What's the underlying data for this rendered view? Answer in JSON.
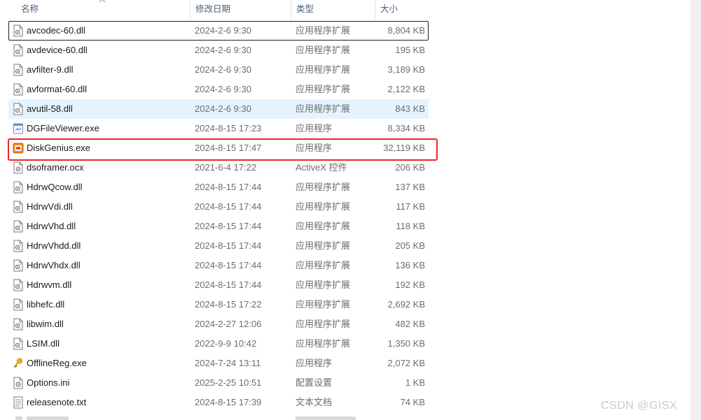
{
  "header": {
    "name": "名称",
    "date": "修改日期",
    "type": "类型",
    "size": "大小"
  },
  "files": [
    {
      "name": "avcodec-60.dll",
      "date": "2024-2-6 9:30",
      "type": "应用程序扩展",
      "size": "8,804 KB",
      "icon": "dll-file-icon"
    },
    {
      "name": "avdevice-60.dll",
      "date": "2024-2-6 9:30",
      "type": "应用程序扩展",
      "size": "195 KB",
      "icon": "dll-file-icon"
    },
    {
      "name": "avfilter-9.dll",
      "date": "2024-2-6 9:30",
      "type": "应用程序扩展",
      "size": "3,189 KB",
      "icon": "dll-file-icon"
    },
    {
      "name": "avformat-60.dll",
      "date": "2024-2-6 9:30",
      "type": "应用程序扩展",
      "size": "2,122 KB",
      "icon": "dll-file-icon"
    },
    {
      "name": "avutil-58.dll",
      "date": "2024-2-6 9:30",
      "type": "应用程序扩展",
      "size": "843 KB",
      "icon": "dll-file-icon"
    },
    {
      "name": "DGFileViewer.exe",
      "date": "2024-8-15 17:23",
      "type": "应用程序",
      "size": "8,334 KB",
      "icon": "exe-generic-icon"
    },
    {
      "name": "DiskGenius.exe",
      "date": "2024-8-15 17:47",
      "type": "应用程序",
      "size": "32,119 KB",
      "icon": "diskgenius-app-icon"
    },
    {
      "name": "dsoframer.ocx",
      "date": "2021-6-4 17:22",
      "type": "ActiveX 控件",
      "size": "206 KB",
      "icon": "ocx-file-icon"
    },
    {
      "name": "HdrwQcow.dll",
      "date": "2024-8-15 17:44",
      "type": "应用程序扩展",
      "size": "137 KB",
      "icon": "dll-file-icon"
    },
    {
      "name": "HdrwVdi.dll",
      "date": "2024-8-15 17:44",
      "type": "应用程序扩展",
      "size": "117 KB",
      "icon": "dll-file-icon"
    },
    {
      "name": "HdrwVhd.dll",
      "date": "2024-8-15 17:44",
      "type": "应用程序扩展",
      "size": "118 KB",
      "icon": "dll-file-icon"
    },
    {
      "name": "HdrwVhdd.dll",
      "date": "2024-8-15 17:44",
      "type": "应用程序扩展",
      "size": "205 KB",
      "icon": "dll-file-icon"
    },
    {
      "name": "HdrwVhdx.dll",
      "date": "2024-8-15 17:44",
      "type": "应用程序扩展",
      "size": "136 KB",
      "icon": "dll-file-icon"
    },
    {
      "name": "Hdrwvm.dll",
      "date": "2024-8-15 17:44",
      "type": "应用程序扩展",
      "size": "192 KB",
      "icon": "dll-file-icon"
    },
    {
      "name": "libhefc.dll",
      "date": "2024-8-15 17:22",
      "type": "应用程序扩展",
      "size": "2,692 KB",
      "icon": "dll-file-icon"
    },
    {
      "name": "libwim.dll",
      "date": "2024-2-27 12:06",
      "type": "应用程序扩展",
      "size": "482 KB",
      "icon": "dll-file-icon"
    },
    {
      "name": "LSIM.dll",
      "date": "2022-9-9 10:42",
      "type": "应用程序扩展",
      "size": "1,350 KB",
      "icon": "dll-file-icon"
    },
    {
      "name": "OfflineReg.exe",
      "date": "2024-7-24 13:11",
      "type": "应用程序",
      "size": "2,072 KB",
      "icon": "key-app-icon"
    },
    {
      "name": "Options.ini",
      "date": "2025-2-25 10:51",
      "type": "配置设置",
      "size": "1 KB",
      "icon": "ini-settings-icon"
    },
    {
      "name": "releasenote.txt",
      "date": "2024-8-15 17:39",
      "type": "文本文档",
      "size": "74 KB",
      "icon": "txt-file-icon"
    }
  ],
  "watermark": "CSDN @GISX",
  "colors": {
    "header_text": "#4c607a",
    "secondary_text": "#6d6d6d",
    "hover_row": "#e5f3ff",
    "highlight_box": "#e8262b"
  }
}
